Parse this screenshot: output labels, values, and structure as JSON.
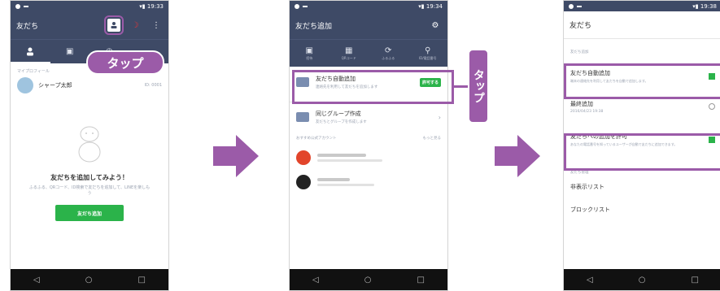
{
  "screen1": {
    "header_title": "友だち",
    "section_label": "マイプロフィール",
    "profile_name": "シャープ太郎",
    "profile_meta": "ID: 0001",
    "empty_title": "友だちを追加してみよう！",
    "empty_desc": "ふるふる、QRコード、ID検索で友だちを追加して、LINEを楽しもう",
    "add_button": "友だち追加",
    "callout": "タップ"
  },
  "screen2": {
    "header_title": "友だち追加",
    "tab_labels": [
      "招待",
      "QRコード",
      "ふるふる",
      "ID/電話番号"
    ],
    "auto_add_title": "友だち自動追加",
    "auto_add_desc": "連絡先を利用して友だちを追加します",
    "auto_add_button": "許可する",
    "group_title": "同じグループ作成",
    "group_desc": "友だちとグループを作成します",
    "recommend_label": "おすすめ公式アカウント",
    "recommend_more": "もっと見る",
    "callout": "タップ"
  },
  "screen3": {
    "header_title": "友だち",
    "section1": "友だち追加",
    "auto_add_title": "友だち自動追加",
    "auto_add_desc": "端末の連絡先を利用して友だちを自動で追加します。",
    "refresh_title": "最終追加",
    "refresh_desc": "2016/04/23 19:38",
    "allow_add_title": "友だちへの追加を許可",
    "allow_add_desc": "あなたの電話番号を知っているユーザーが自動で友だちに追加できます。",
    "section2": "友だち管理",
    "hidden_list": "非表示リスト",
    "block_list": "ブロックリスト"
  },
  "colors": {
    "accent": "#9b5ba8",
    "line_green": "#2bb34a",
    "navy": "#3e4a66"
  }
}
